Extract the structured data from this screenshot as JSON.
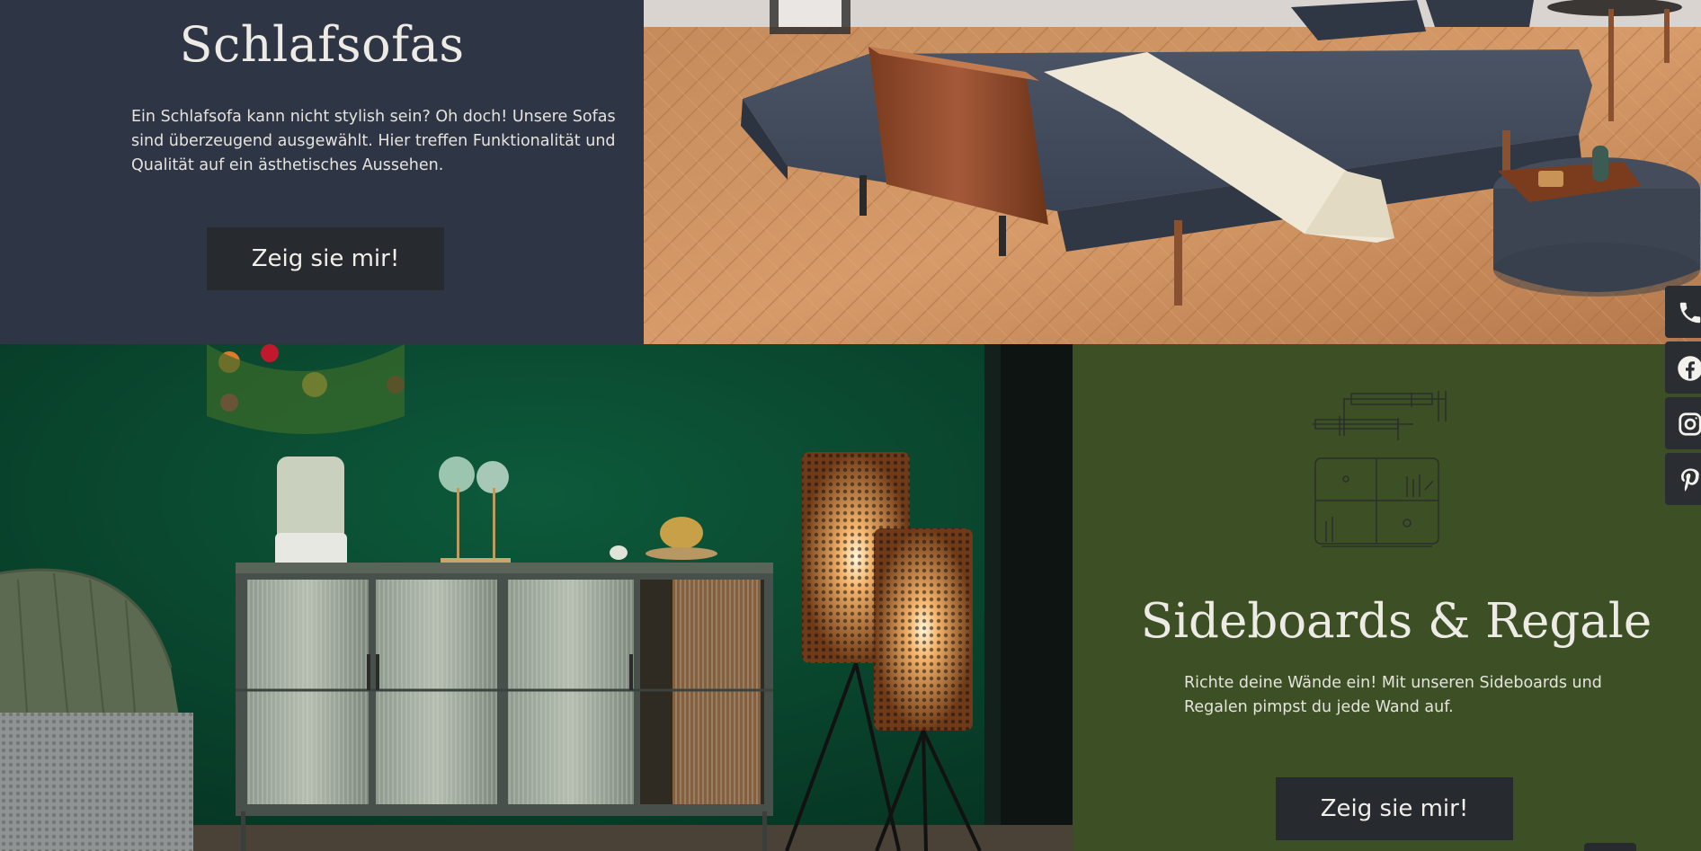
{
  "colors": {
    "sofas_panel_bg": "#2e3645",
    "sideboards_panel_bg": "#3d5025",
    "button_bg": "#272a2e",
    "text_light": "#eeebe6"
  },
  "sofas": {
    "title": "Schlafsofas",
    "description": "Ein Schlafsofa kann nicht stylish sein? Oh doch! Unsere Sofas sind überzeugend ausgewählt. Hier treffen Funktionalität und Qualität auf ein ästhetisches Aussehen.",
    "button_label": "Zeig sie mir!"
  },
  "sideboards": {
    "title": "Sideboards & Regale",
    "description": "Richte deine Wände ein! Mit unseren Sideboards und Regalen pimpst du jede Wand auf.",
    "button_label": "Zeig sie mir!",
    "icon": "shelf-line-illustration"
  },
  "social": [
    {
      "name": "phone",
      "icon": "phone-icon"
    },
    {
      "name": "facebook",
      "icon": "facebook-icon"
    },
    {
      "name": "instagram",
      "icon": "instagram-icon"
    },
    {
      "name": "pinterest",
      "icon": "pinterest-icon"
    }
  ]
}
